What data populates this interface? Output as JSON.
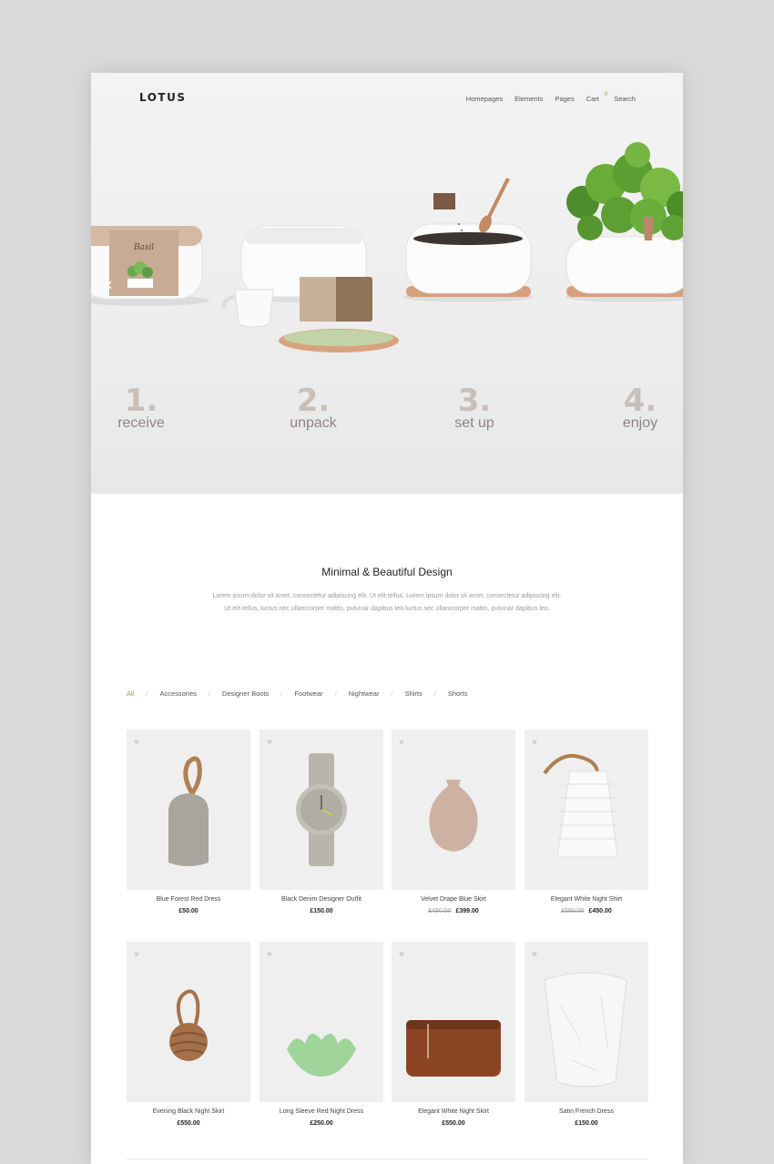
{
  "header": {
    "logo": "LOTUS",
    "nav": [
      "Homepages",
      "Elements",
      "Pages",
      "Cart",
      "Search"
    ],
    "cart_count": "0"
  },
  "hero": {
    "steps": [
      {
        "num": "1.",
        "label": "receive"
      },
      {
        "num": "2.",
        "label": "unpack"
      },
      {
        "num": "3.",
        "label": "set up"
      },
      {
        "num": "4.",
        "label": "enjoy"
      }
    ],
    "box_label": "Basil"
  },
  "intro": {
    "title": "Minimal & Beautiful Design",
    "line1": "Lorem ipsum dolor sit amet, consectetur adipiscing elit. Ut elit tellus, Lorem ipsum dolor sit amet, consectetur adipiscing elit.",
    "line2": "Ut elit tellus, luctus nec ullamcorper mattis, pulvinar dapibus leo luctus nec ullamcorper mattis, pulvinar dapibus leo."
  },
  "filters": [
    "All",
    "Accessories",
    "Designer Boots",
    "Footwear",
    "Nightwear",
    "Shirts",
    "Shorts"
  ],
  "products": [
    {
      "name": "Blue Forest Red Dress",
      "old_price": "",
      "price": "£50.00",
      "icon": "rope-doorstop"
    },
    {
      "name": "Black Denim Designer Outfit",
      "old_price": "",
      "price": "£150.00",
      "icon": "watch"
    },
    {
      "name": "Velvet Drape Blue Skirt",
      "old_price": "£450.00",
      "price": "£399.00",
      "icon": "vase"
    },
    {
      "name": "Elegant White Night Shirt",
      "old_price": "£550.00",
      "price": "£450.00",
      "icon": "lantern"
    },
    {
      "name": "Evening Black Night Skirt",
      "old_price": "",
      "price": "£550.00",
      "icon": "rope-knot"
    },
    {
      "name": "Long Sleeve Red Night Dress",
      "old_price": "",
      "price": "£250.00",
      "icon": "lotus-bowl"
    },
    {
      "name": "Elegant White Night Skirt",
      "old_price": "",
      "price": "£550.00",
      "icon": "leather-bag"
    },
    {
      "name": "Satin French Dress",
      "old_price": "",
      "price": "£150.00",
      "icon": "paper-bag"
    }
  ],
  "colors": {
    "accent": "#7fb241",
    "step_number": "#c9bfb9",
    "step_label": "#8e8481"
  }
}
